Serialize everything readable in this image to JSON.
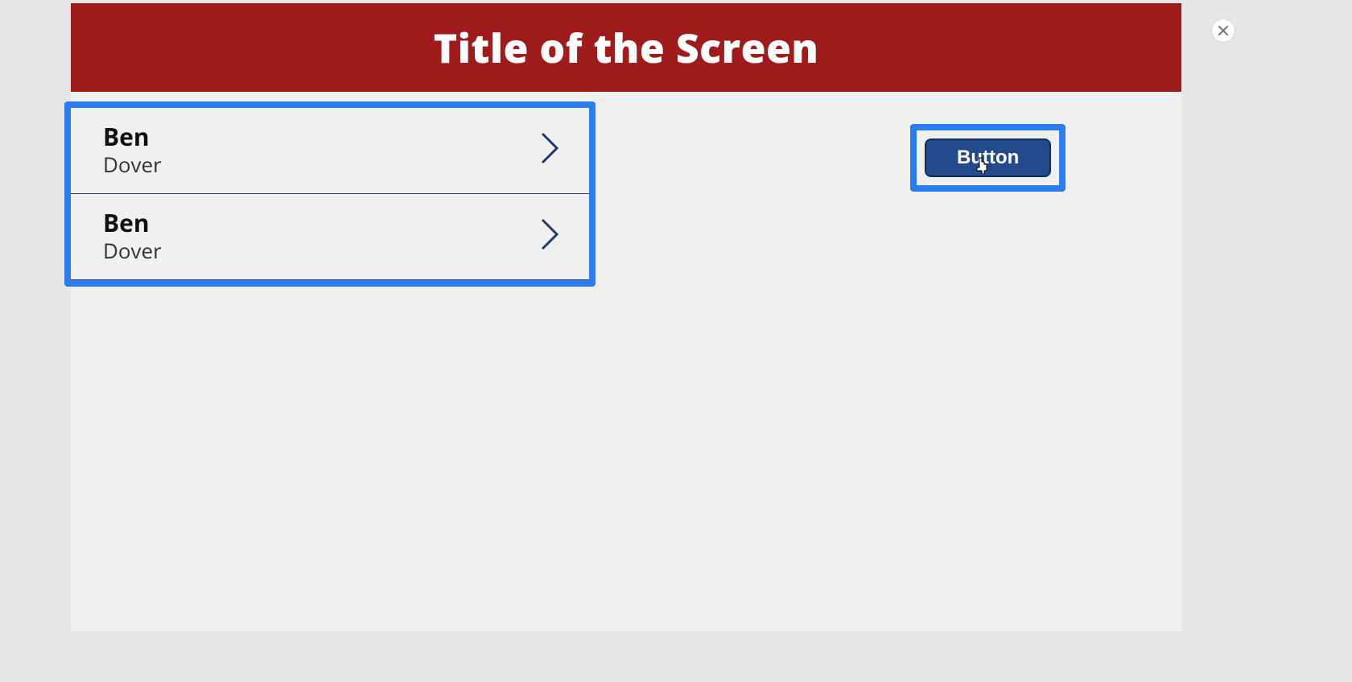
{
  "header": {
    "title": "Title of the Screen"
  },
  "list": {
    "items": [
      {
        "primary": "Ben",
        "secondary": "Dover"
      },
      {
        "primary": "Ben",
        "secondary": "Dover"
      }
    ]
  },
  "action": {
    "button_label": "Button"
  },
  "colors": {
    "highlight": "#2a7cf0",
    "header_bg": "#a01c1c",
    "button_bg": "#234a8a"
  }
}
